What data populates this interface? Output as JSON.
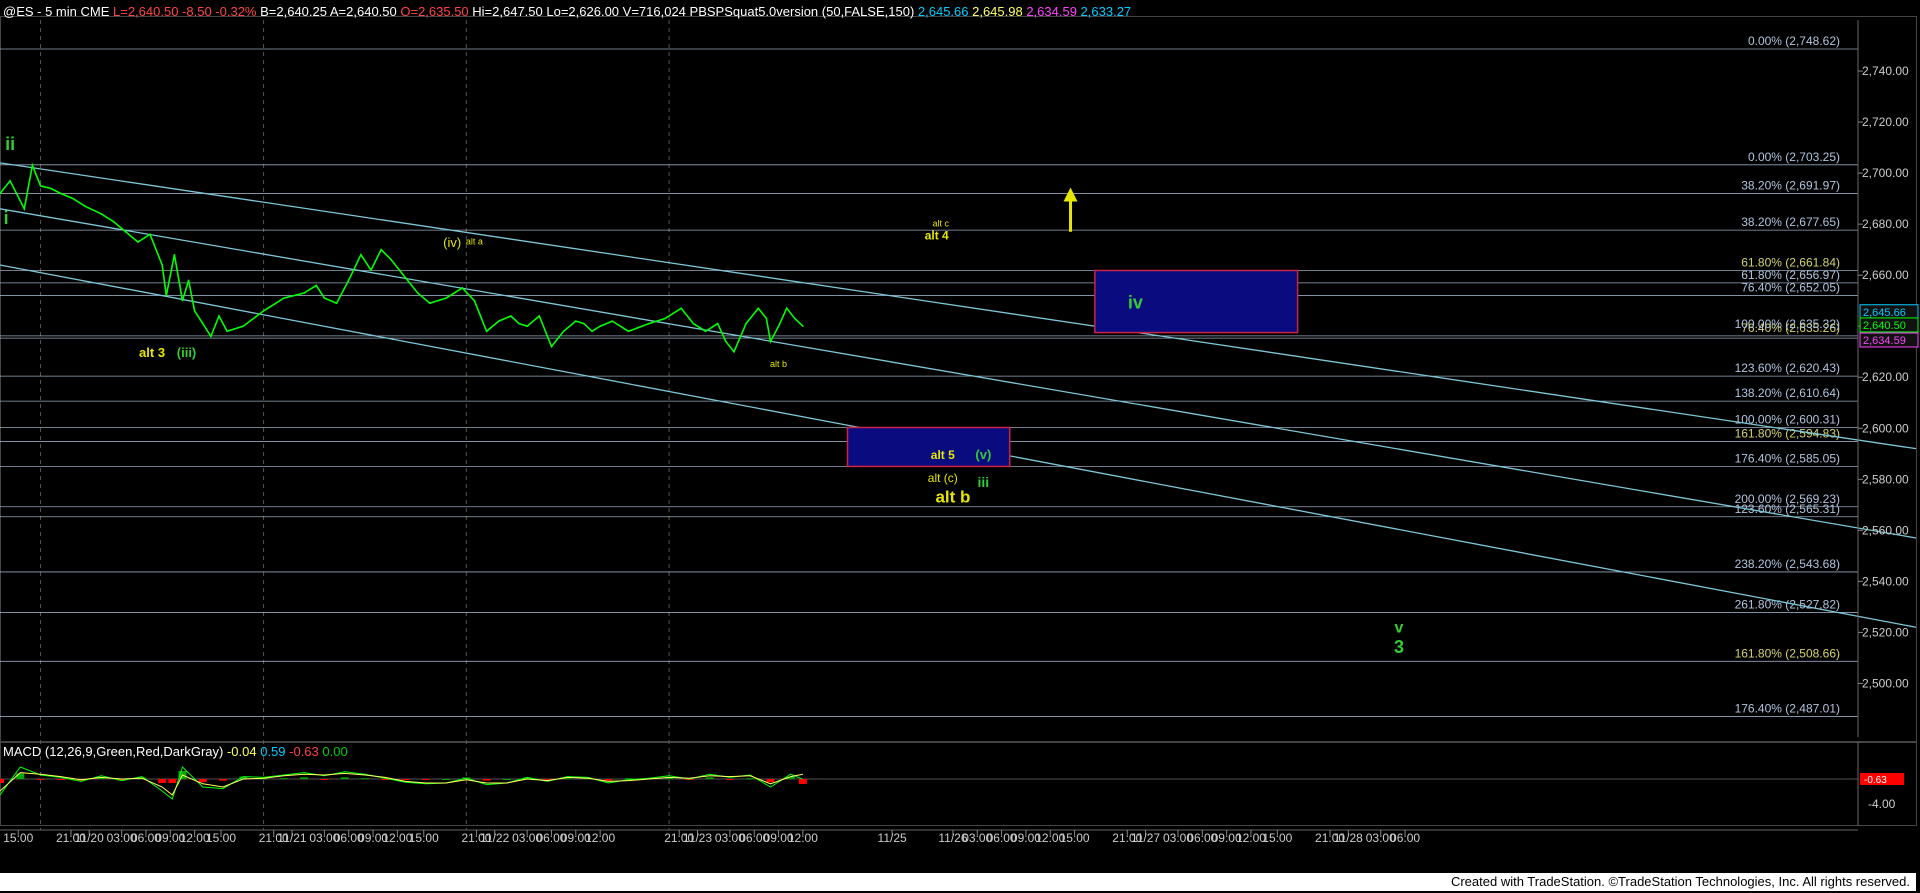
{
  "header": {
    "symbol": "@ES - 5 min  CME",
    "last": "L=2,640.50",
    "change": "-8.50",
    "change_pct": "-0.32%",
    "bid": "B=2,640.25",
    "ask": "A=2,640.50",
    "open": "O=2,635.50",
    "high": "Hi=2,647.50",
    "low": "Lo=2,626.00",
    "volume": "V=716,024",
    "indicator": "PBSPSquat5.0version (50,FALSE,150)",
    "ind_values": [
      "2,645.66",
      "2,645.98",
      "2,634.59",
      "2,633.27"
    ]
  },
  "macd": {
    "label": "MACD (12,26,9,Green,Red,DarkGray)",
    "values": [
      "-0.04",
      "0.59",
      "-0.63",
      "0.00"
    ],
    "scale_label": "-4.00",
    "current_label": "-0.63"
  },
  "footer": {
    "credit": "Created with TradeStation. ©TradeStation Technologies, Inc. All rights reserved."
  },
  "colors": {
    "background": "#000000",
    "price": "#00ff00",
    "channel": "#7fc6d6",
    "fib_line": "#b0c4de",
    "fib_label": "#b0c4de",
    "fib_label_yellow": "#d4d46a",
    "wave_green": "#33cc33",
    "wave_yellow": "#e6e600",
    "box_fill": "#0b0b80",
    "box_border": "#cc2244",
    "macd_red": "#ff0000",
    "macd_green": "#00aa00"
  },
  "chart_data": {
    "type": "line",
    "title": "@ES - 5 min CME",
    "xlabel": "",
    "ylabel": "",
    "ylim": [
      2479,
      2760
    ],
    "y_ticks": [
      2500,
      2520,
      2540,
      2560,
      2580,
      2600,
      2620,
      2640,
      2660,
      2680,
      2700,
      2720,
      2740
    ],
    "y_tick_labels": [
      "2,500.00",
      "2,520.00",
      "2,540.00",
      "2,560.00",
      "2,580.00",
      "2,600.00",
      "2,620.00",
      "2,640.00",
      "2,660.00",
      "2,680.00",
      "2,700.00",
      "2,720.00",
      "2,740.00"
    ],
    "x_range": [
      -0.3,
      9.15
    ],
    "x_ticks": [
      {
        "t": -0.21,
        "label": "15:00"
      },
      {
        "t": 0.05,
        "label": "21:00"
      },
      {
        "t": 0.14,
        "label": "11/20"
      },
      {
        "t": 0.3,
        "label": "03:00"
      },
      {
        "t": 0.42,
        "label": "06:00"
      },
      {
        "t": 0.54,
        "label": "09:00"
      },
      {
        "t": 0.66,
        "label": "12:00"
      },
      {
        "t": 0.79,
        "label": "15:00"
      },
      {
        "t": 1.05,
        "label": "21:00"
      },
      {
        "t": 1.14,
        "label": "11/21"
      },
      {
        "t": 1.3,
        "label": "03:00"
      },
      {
        "t": 1.42,
        "label": "06:00"
      },
      {
        "t": 1.54,
        "label": "09:00"
      },
      {
        "t": 1.66,
        "label": "12:00"
      },
      {
        "t": 1.79,
        "label": "15:00"
      },
      {
        "t": 2.05,
        "label": "21:00"
      },
      {
        "t": 2.14,
        "label": "11/22"
      },
      {
        "t": 2.3,
        "label": "03:00"
      },
      {
        "t": 2.42,
        "label": "06:00"
      },
      {
        "t": 2.54,
        "label": "09:00"
      },
      {
        "t": 2.66,
        "label": "12:00"
      },
      {
        "t": 3.05,
        "label": "21:00"
      },
      {
        "t": 3.14,
        "label": "11/23"
      },
      {
        "t": 3.3,
        "label": "03:00"
      },
      {
        "t": 3.42,
        "label": "06:00"
      },
      {
        "t": 3.54,
        "label": "09:00"
      },
      {
        "t": 3.66,
        "label": "12:00"
      },
      {
        "t": 4.1,
        "label": "11/25"
      },
      {
        "t": 4.4,
        "label": "11/26"
      },
      {
        "t": 4.52,
        "label": "03:00"
      },
      {
        "t": 4.64,
        "label": "06:00"
      },
      {
        "t": 4.76,
        "label": "09:00"
      },
      {
        "t": 4.88,
        "label": "12:00"
      },
      {
        "t": 5.0,
        "label": "15:00"
      },
      {
        "t": 5.26,
        "label": "21:00"
      },
      {
        "t": 5.35,
        "label": "11/27"
      },
      {
        "t": 5.51,
        "label": "03:00"
      },
      {
        "t": 5.63,
        "label": "06:00"
      },
      {
        "t": 5.75,
        "label": "09:00"
      },
      {
        "t": 5.87,
        "label": "12:00"
      },
      {
        "t": 6.0,
        "label": "15:00"
      },
      {
        "t": 6.26,
        "label": "21:00"
      },
      {
        "t": 6.35,
        "label": "11/28"
      },
      {
        "t": 6.51,
        "label": "03:00"
      },
      {
        "t": 6.63,
        "label": "06:00"
      }
    ],
    "series": [
      {
        "key": "price",
        "x": [
          -0.3,
          -0.25,
          -0.18,
          -0.14,
          -0.1,
          -0.05,
          0.0,
          0.06,
          0.12,
          0.2,
          0.26,
          0.32,
          0.38,
          0.44,
          0.5,
          0.52,
          0.56,
          0.6,
          0.63,
          0.66,
          0.7,
          0.74,
          0.78,
          0.82,
          0.9,
          1.0,
          1.1,
          1.2,
          1.26,
          1.3,
          1.36,
          1.42,
          1.48,
          1.53,
          1.58,
          1.63,
          1.7,
          1.76,
          1.82,
          1.9,
          1.98,
          2.04,
          2.1,
          2.16,
          2.22,
          2.26,
          2.3,
          2.36,
          2.42,
          2.48,
          2.54,
          2.58,
          2.62,
          2.66,
          2.72,
          2.8,
          2.9,
          2.98,
          3.06,
          3.12,
          3.18,
          3.24,
          3.28,
          3.32,
          3.38,
          3.44,
          3.48,
          3.5,
          3.54,
          3.58,
          3.62,
          3.66
        ],
        "y": [
          2692,
          2697,
          2686,
          2703,
          2695,
          2694,
          2692,
          2690,
          2687,
          2684,
          2681,
          2677,
          2673,
          2676,
          2664,
          2652,
          2668,
          2650,
          2658,
          2646,
          2641,
          2636,
          2644,
          2638,
          2640,
          2646,
          2651,
          2653,
          2656,
          2651,
          2649,
          2658,
          2668,
          2662,
          2670,
          2666,
          2659,
          2653,
          2649,
          2651,
          2655,
          2650,
          2638,
          2642,
          2644,
          2641,
          2640,
          2644,
          2632,
          2638,
          2642,
          2641,
          2638,
          2640,
          2642,
          2638,
          2641,
          2643,
          2647,
          2641,
          2638,
          2641,
          2634,
          2630,
          2641,
          2647,
          2643,
          2634,
          2640,
          2647,
          2643,
          2640
        ]
      }
    ],
    "macd_series": {
      "x": [
        -0.3,
        -0.2,
        -0.1,
        0.0,
        0.1,
        0.2,
        0.3,
        0.4,
        0.5,
        0.55,
        0.6,
        0.7,
        0.8,
        0.9,
        1.0,
        1.1,
        1.2,
        1.3,
        1.4,
        1.5,
        1.6,
        1.7,
        1.8,
        1.9,
        2.0,
        2.1,
        2.2,
        2.3,
        2.4,
        2.5,
        2.6,
        2.7,
        2.8,
        2.9,
        3.0,
        3.1,
        3.2,
        3.3,
        3.4,
        3.5,
        3.6,
        3.66
      ],
      "macd": [
        -2,
        1.5,
        0.5,
        0.2,
        -0.3,
        0.4,
        -0.2,
        0.3,
        -1.5,
        -2.5,
        1.5,
        -1.0,
        -1.2,
        0.3,
        0.2,
        0.5,
        0.8,
        0.4,
        0.9,
        0.6,
        0.1,
        -0.4,
        -0.6,
        -0.5,
        0.1,
        -0.7,
        -0.5,
        0.2,
        -0.3,
        0.3,
        0.2,
        -0.5,
        -0.1,
        0.1,
        0.4,
        0.0,
        0.6,
        0.2,
        0.5,
        -1.0,
        0.6,
        -0.04
      ],
      "signal": [
        -1.5,
        0.8,
        0.6,
        0.3,
        -0.1,
        0.2,
        0.0,
        0.1,
        -1.0,
        -2.0,
        0.5,
        -0.6,
        -1.0,
        0.0,
        0.1,
        0.4,
        0.6,
        0.5,
        0.7,
        0.5,
        0.2,
        -0.3,
        -0.5,
        -0.5,
        -0.1,
        -0.5,
        -0.5,
        0.0,
        -0.2,
        0.2,
        0.1,
        -0.3,
        -0.2,
        0.0,
        0.2,
        0.1,
        0.4,
        0.3,
        0.4,
        -0.6,
        0.3,
        0.59
      ]
    },
    "fib_levels": [
      {
        "price": 2748.62,
        "label": "0.00% (2,748.62)"
      },
      {
        "price": 2703.25,
        "label": "0.00% (2,703.25)"
      },
      {
        "price": 2691.97,
        "label": "38.20% (2,691.97)"
      },
      {
        "price": 2677.65,
        "label": "38.20% (2,677.65)"
      },
      {
        "price": 2661.84,
        "label": "61.80% (2,661.84)",
        "yellow": true
      },
      {
        "price": 2656.97,
        "label": "61.80% (2,656.97)"
      },
      {
        "price": 2652.05,
        "label": "76.40% (2,652.05)"
      },
      {
        "price": 2636.2,
        "label": "76.40% (2,635.26)",
        "yellow": true
      },
      {
        "price": 2635.32,
        "label": "100.00% (2,635.32)",
        "offset": -6
      },
      {
        "price": 2620.43,
        "label": "123.60% (2,620.43)"
      },
      {
        "price": 2610.64,
        "label": "138.20% (2,610.64)"
      },
      {
        "price": 2600.31,
        "label": "100.00% (2,600.31)"
      },
      {
        "price": 2594.83,
        "label": "161.80% (2,594.83)",
        "yellow": true
      },
      {
        "price": 2585.05,
        "label": "176.40% (2,585.05)"
      },
      {
        "price": 2569.23,
        "label": "200.00% (2,569.23)"
      },
      {
        "price": 2565.31,
        "label": "123.60% (2,565.31)"
      },
      {
        "price": 2543.68,
        "label": "238.20% (2,543.68)"
      },
      {
        "price": 2527.82,
        "label": "261.80% (2,527.82)"
      },
      {
        "price": 2508.66,
        "label": "161.80% (2,508.66)",
        "yellow": true
      },
      {
        "price": 2487.01,
        "label": "176.40% (2,487.01)"
      }
    ],
    "channels": [
      {
        "x1": -0.3,
        "y1": 2704,
        "x2": 9.15,
        "y2": 2592
      },
      {
        "x1": -0.3,
        "y1": 2686,
        "x2": 9.15,
        "y2": 2557
      },
      {
        "x1": -0.3,
        "y1": 2664,
        "x2": 9.15,
        "y2": 2522
      }
    ],
    "vertical_separators": [
      -0.1,
      1.0,
      2.0,
      3.0
    ],
    "boxes": [
      {
        "x1": 3.88,
        "x2": 4.68,
        "y1": 2600.31,
        "y2": 2585.05
      },
      {
        "x1": 5.1,
        "x2": 6.1,
        "y1": 2661.84,
        "y2": 2637.5
      }
    ],
    "right_axis_tags": [
      {
        "price": 2645.66,
        "label": "2,645.66",
        "color": "#00ccff"
      },
      {
        "price": 2640.5,
        "label": "2,640.50",
        "color": "#00ff00"
      },
      {
        "price": 2634.59,
        "label": "2,634.59",
        "color": "#ff44ff"
      }
    ],
    "annotations": [
      {
        "text": "ii",
        "x": -0.25,
        "y": 2709,
        "color": "green",
        "size": 18,
        "bold": true
      },
      {
        "text": "i",
        "x": -0.27,
        "y": 2680,
        "color": "green",
        "size": 18,
        "bold": true
      },
      {
        "text": "alt 3",
        "x": 0.45,
        "y": 2628,
        "color": "yellow",
        "size": 13,
        "bold": true
      },
      {
        "text": "(iii)",
        "x": 0.62,
        "y": 2628,
        "color": "green",
        "size": 13,
        "bold": true
      },
      {
        "text": "(iv)",
        "x": 1.93,
        "y": 2671,
        "color": "yellow",
        "size": 13,
        "bold": false
      },
      {
        "text": "alt a",
        "x": 2.04,
        "y": 2672,
        "color": "yellow",
        "size": 9,
        "bold": false
      },
      {
        "text": "alt b",
        "x": 3.54,
        "y": 2624,
        "color": "yellow",
        "size": 9,
        "bold": false
      },
      {
        "text": "alt 4",
        "x": 4.32,
        "y": 2674,
        "color": "yellow",
        "size": 12,
        "bold": true
      },
      {
        "text": "alt c",
        "x": 4.34,
        "y": 2679,
        "color": "yellow",
        "size": 9,
        "bold": false
      },
      {
        "text": "alt 5",
        "x": 4.35,
        "y": 2588,
        "color": "yellow",
        "size": 12,
        "bold": true
      },
      {
        "text": "(v)",
        "x": 4.55,
        "y": 2588,
        "color": "green",
        "size": 13,
        "bold": true
      },
      {
        "text": "alt (c)",
        "x": 4.35,
        "y": 2579,
        "color": "yellow",
        "size": 12,
        "bold": false
      },
      {
        "text": "alt b",
        "x": 4.4,
        "y": 2571,
        "color": "yellow",
        "size": 17,
        "bold": true
      },
      {
        "text": "iii",
        "x": 4.55,
        "y": 2577,
        "color": "green",
        "size": 14,
        "bold": true
      },
      {
        "text": "iv",
        "x": 5.3,
        "y": 2647,
        "color": "green",
        "size": 18,
        "bold": true
      },
      {
        "text": "v",
        "x": 6.6,
        "y": 2520,
        "color": "green",
        "size": 16,
        "bold": true
      },
      {
        "text": "3",
        "x": 6.6,
        "y": 2512,
        "color": "green",
        "size": 18,
        "bold": true
      }
    ],
    "arrow": {
      "x": 4.98,
      "y_from": 2677,
      "y_to": 2692
    }
  }
}
